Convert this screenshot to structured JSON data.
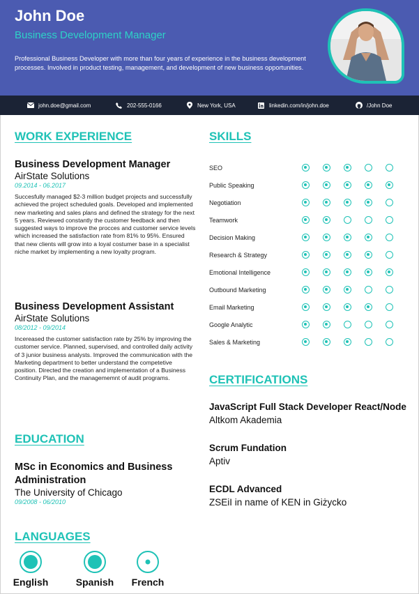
{
  "header": {
    "name": "John Doe",
    "title": "Business Development Manager",
    "summary": "Professional Business Developer with more than four years of experience in the business development processes. Involved in product testing, management, and development of new business opportunities."
  },
  "contact": [
    {
      "icon": "email-icon",
      "text": "john.doe@gmail.com"
    },
    {
      "icon": "phone-icon",
      "text": "202-555-0166"
    },
    {
      "icon": "location-icon",
      "text": "New York, USA"
    },
    {
      "icon": "linkedin-icon",
      "text": "linkedin.com/in/john.doe"
    },
    {
      "icon": "github-icon",
      "text": "/John Doe"
    }
  ],
  "work": {
    "heading": "WORK EXPERIENCE",
    "jobs": [
      {
        "title": "Business Development Manager",
        "company": "AirState Solutions",
        "dates": "09.2014 - 06.2017",
        "description": "Succesfully managed $2-3 million budget projects and successfully achieved the project scheduled goals. Developed and implemented new marketing and sales plans and defined the strategy for the next 5 years. Reviewed constantly the customer feedback and then suggested ways to improve the procces and customer service levels which increased the satisfaction rate from 81% to 95%. Ensured that new clients will grow into a loyal costumer base in a specialist niche market by implementing a new loyalty program."
      },
      {
        "title": "Business Development Assistant",
        "company": "AirState Solutions",
        "dates": "08/2012 - 09/2014",
        "description": "Incereased the customer satisfaction rate by 25% by improving the customer service. Planned, supervised, and controlled daily activity of 3 junior business analysts. Improved the communication with the Marketing department to better understand the competetive position. Directed the creation and implementation of a Business Continuity Plan, and the managememnt of audit programs."
      }
    ]
  },
  "education": {
    "heading": "EDUCATION",
    "degree": "MSc in Economics and Business Administration",
    "school": "The University of Chicago",
    "dates": "09/2008 - 06/2010"
  },
  "languages": {
    "heading": "LANGUAGES",
    "items": [
      {
        "name": "English",
        "level": 0.75
      },
      {
        "name": "Spanish",
        "level": 0.75
      },
      {
        "name": "French",
        "level": 0.25
      }
    ]
  },
  "skills": {
    "heading": "SKILLS",
    "max": 5,
    "items": [
      {
        "name": "SEO",
        "level": 3
      },
      {
        "name": "Public Speaking",
        "level": 5
      },
      {
        "name": "Negotiation",
        "level": 4
      },
      {
        "name": "Teamwork",
        "level": 2
      },
      {
        "name": "Decision Making",
        "level": 4
      },
      {
        "name": "Research & Strategy",
        "level": 4
      },
      {
        "name": "Emotional Intelligence",
        "level": 5
      },
      {
        "name": "Outbound Marketing",
        "level": 3
      },
      {
        "name": "Email Marketing",
        "level": 4
      },
      {
        "name": "Google Analytic",
        "level": 2
      },
      {
        "name": "Sales & Marketing",
        "level": 3
      }
    ]
  },
  "certifications": {
    "heading": "CERTIFICATIONS",
    "items": [
      {
        "name": "JavaScript Full Stack Developer React/Node",
        "org": "Altkom Akademia"
      },
      {
        "name": "Scrum Fundation",
        "org": "Aptiv"
      },
      {
        "name": "ECDL Advanced",
        "org": "ZSEiI in name of KEN in Giżycko"
      }
    ]
  },
  "colors": {
    "accent": "#1fc2b6",
    "header_bg": "#4b5bb1",
    "contact_bg": "#1b2335"
  }
}
